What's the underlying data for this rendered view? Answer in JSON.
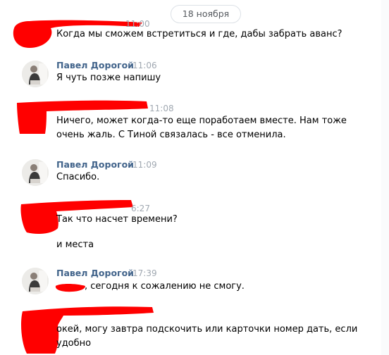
{
  "date_divider": "18 ноября",
  "messages": [
    {
      "author": "",
      "time": "11:00",
      "lines": [
        "Когда мы сможем встретиться и где, дабы забрать аванс?"
      ]
    },
    {
      "author": "Павел Дорогой",
      "time": "11:06",
      "lines": [
        "Я чуть позже напишу"
      ]
    },
    {
      "author": "",
      "time": "11:08",
      "lines": [
        "Ничего, может когда-то еще поработаем вместе. Нам тоже",
        "очень жаль. С Тиной связалась - все отменила."
      ]
    },
    {
      "author": "Павел Дорогой",
      "time": "11:09",
      "lines": [
        "Спасибо."
      ]
    },
    {
      "author": "",
      "time": "6:27",
      "lines": [
        "Так что насчет времени?",
        "и места"
      ]
    },
    {
      "author": "Павел Дорогой",
      "time": "17:39",
      "lines": [
        ", сегодня к сожалению не смогу."
      ]
    },
    {
      "author": "",
      "time": "",
      "lines": [
        "окей, могу завтра подскочить или карточки номер дать, если",
        "удобно"
      ]
    }
  ],
  "colors": {
    "redaction": "#ff0000",
    "author": "#42648b",
    "time": "#a0a8b1"
  }
}
